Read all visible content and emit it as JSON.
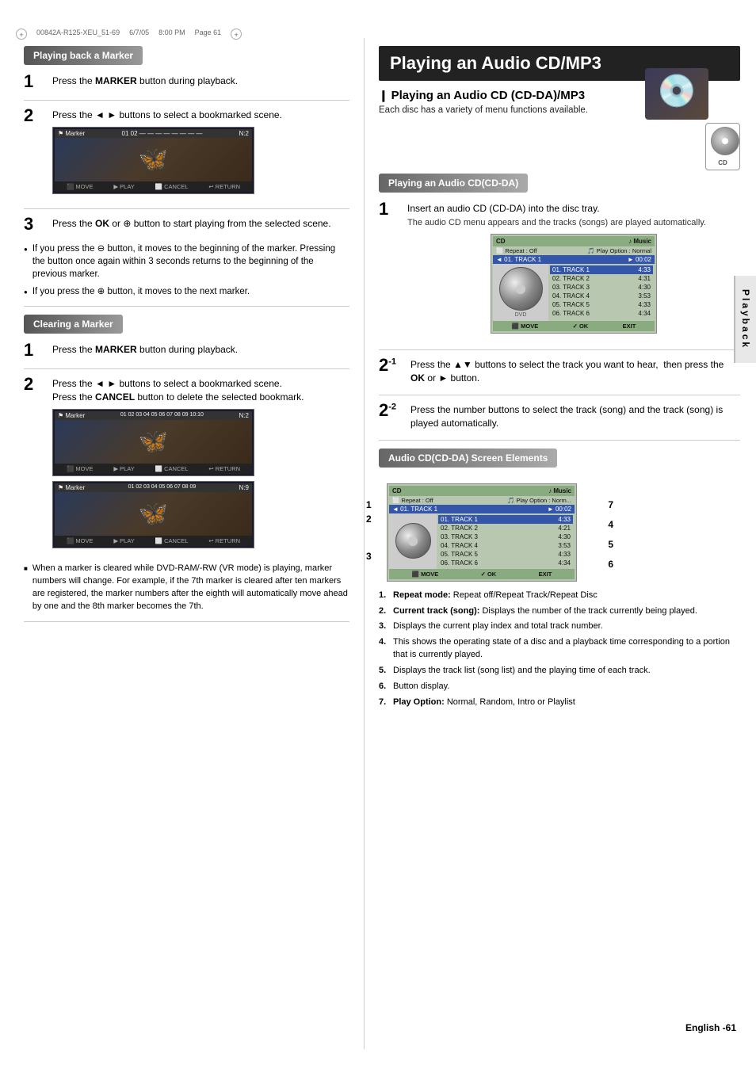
{
  "fileHeader": {
    "filename": "00842A-R125-XEU_51-69",
    "date": "6/7/05",
    "time": "8:00 PM",
    "page": "Page 61"
  },
  "leftCol": {
    "section1": {
      "title": "Playing back a Marker",
      "steps": [
        {
          "num": "1",
          "text": "Press the ",
          "boldText": "MARKER",
          "textAfter": " button during playback."
        },
        {
          "num": "2",
          "text": "Press the ◄ ► buttons to select a bookmarked scene."
        },
        {
          "num": "3",
          "text": "Press the ",
          "boldText": "OK",
          "textAfter": " or  button to start playing from the selected scene."
        }
      ],
      "bullets": [
        "If you press the ⊖ button, it moves to the beginning of the marker. Pressing the button once again within 3 seconds returns to the beginning of the previous marker.",
        "If you press the ⊕ button, it moves to the next marker."
      ],
      "screen": {
        "headerLeft": "⚑ Marker",
        "headerMiddle": "01 02 — — — — — — — —",
        "headerRight": "N:2",
        "toolbar": [
          "⬛ MOVE",
          "▶ PLAY",
          "⬜ CANCEL",
          "↩ RETURN"
        ]
      }
    },
    "section2": {
      "title": "Clearing a Marker",
      "steps": [
        {
          "num": "1",
          "text": "Press the ",
          "boldText": "MARKER",
          "textAfter": " button during playback."
        },
        {
          "num": "2",
          "text": "Press the ◄ ► buttons to select a bookmarked scene.\nPress the ",
          "boldText": "CANCEL",
          "textAfter": " button to delete the selected bookmark."
        }
      ],
      "squareBullets": [
        "When a marker is cleared while DVD-RAM/-RW (VR mode) is playing, marker numbers will change. For example, if the 7th marker is cleared after ten markers are registered, the marker numbers after the eighth will automatically move ahead by one and the 8th marker becomes the 7th."
      ],
      "screen1": {
        "headerLeft": "⚑ Marker",
        "headerMiddle": "01 02 03 04 05 06 07 08 09 10:10",
        "headerRight": "N:2",
        "toolbar": [
          "⬛ MOVE",
          "▶ PLAY",
          "⬜ CANCEL",
          "↩ RETURN"
        ]
      },
      "screen2": {
        "headerLeft": "⚑ Marker",
        "headerMiddle": "01 02 03 04 05 06 07 08 09",
        "headerRight": "N:9",
        "toolbar": [
          "⬛ MOVE",
          "▶ PLAY",
          "⬜ CANCEL",
          "↩ RETURN"
        ]
      }
    }
  },
  "rightCol": {
    "mainTitle": "Playing an Audio CD/MP3",
    "bgImage": "cd-cover",
    "subTitle1": "Playing an Audio CD (CD-DA)/MP3",
    "subDesc1": "Each disc has a variety of menu functions available.",
    "cdIconLabel": "CD",
    "section_cdda": {
      "title": "Playing an Audio CD(CD-DA)",
      "step1": {
        "num": "1",
        "text": "Insert an audio CD (CD-DA) into the disc tray.",
        "subtext": "The audio CD menu appears and the tracks (songs) are played automatically."
      },
      "step21": {
        "num": "2",
        "sup": "-1",
        "text": "Press the ▲▼ buttons to select the track you want to hear,  then press the ",
        "boldText": "OK",
        "textAfter": " or ► button."
      },
      "step22": {
        "num": "2",
        "sup": "-2",
        "text": "Press the number buttons to select the track (song) and the track (song) is played automatically."
      }
    },
    "cdScreen": {
      "headerLeft": "CD",
      "headerRight": "♪ Music",
      "subHeaderLeft": "Repeat : Off",
      "subHeaderRight": "Play Option : Normal",
      "trackHighlight": "01. TRACK 1",
      "trackHighlightTime": "► 00:02",
      "tracks": [
        {
          "name": "01. TRACK 1",
          "time": "4:33"
        },
        {
          "name": "02. TRACK 2",
          "time": "4:31"
        },
        {
          "name": "03. TRACK 3",
          "time": "4:30"
        },
        {
          "name": "04. TRACK 4",
          "time": "3:53"
        },
        {
          "name": "05. TRACK 5",
          "time": "4:33"
        },
        {
          "name": "06. TRACK 6",
          "time": "4:34"
        }
      ],
      "footer": [
        "⬛ MOVE",
        "✓ OK",
        "EXIT"
      ]
    },
    "section_screenElements": {
      "title": "Audio CD(CD-DA) Screen Elements",
      "callouts": [
        {
          "num": "1",
          "desc": ""
        },
        {
          "num": "2",
          "desc": ""
        },
        {
          "num": "3",
          "desc": ""
        },
        {
          "num": "4",
          "desc": ""
        },
        {
          "num": "5",
          "desc": ""
        },
        {
          "num": "6",
          "desc": ""
        },
        {
          "num": "7",
          "desc": ""
        }
      ],
      "legend": [
        {
          "num": "1",
          "label": "Repeat mode:",
          "text": "Repeat off/Repeat Track/Repeat Disc"
        },
        {
          "num": "2",
          "label": "Current track (song):",
          "text": "Displays the number of the track currently being played."
        },
        {
          "num": "3",
          "label": "",
          "text": "Displays the current play index and total track number."
        },
        {
          "num": "4",
          "label": "",
          "text": "This shows the operating state of a disc and a playback time corresponding to a portion that is currently played."
        },
        {
          "num": "5",
          "label": "",
          "text": "Displays the track list (song list) and the playing time of each track."
        },
        {
          "num": "6",
          "label": "",
          "text": "Button display."
        },
        {
          "num": "7",
          "label": "Play Option:",
          "text": "Normal, Random, Intro or Playlist"
        }
      ]
    }
  },
  "pageNumber": "English -61",
  "playbackLabel": "Playback"
}
